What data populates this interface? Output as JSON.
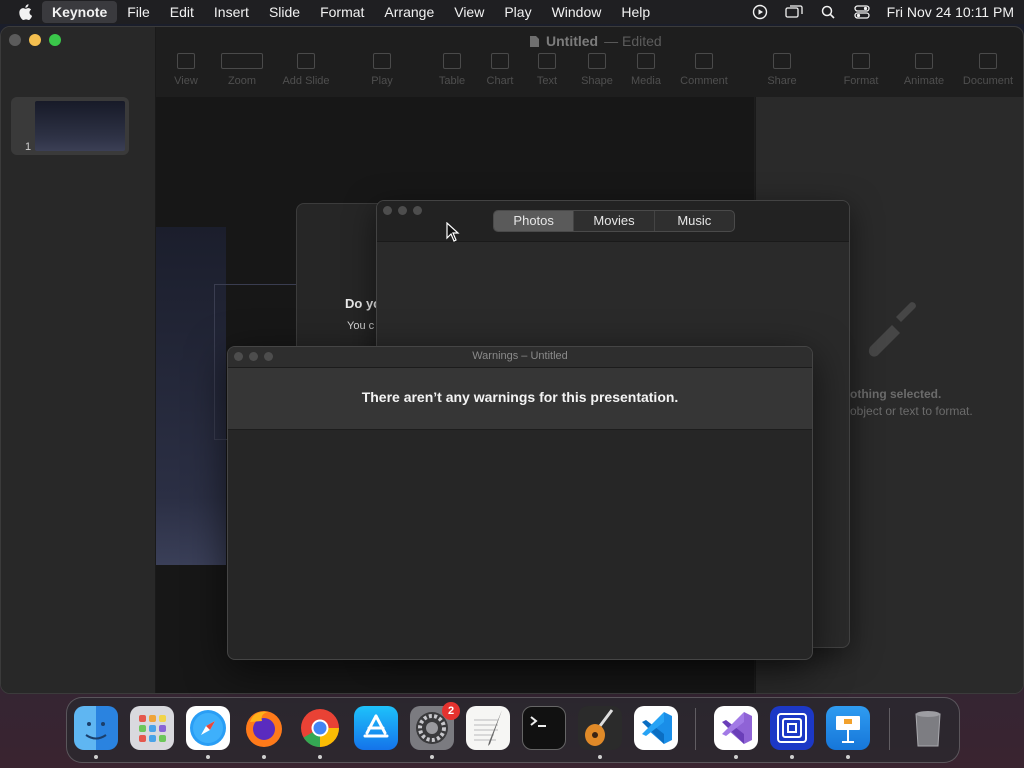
{
  "menubar": {
    "app_name": "Keynote",
    "items": [
      "File",
      "Edit",
      "Insert",
      "Slide",
      "Format",
      "Arrange",
      "View",
      "Play",
      "Window",
      "Help"
    ],
    "clock": "Fri Nov 24  10:11 PM"
  },
  "keynote": {
    "doc_title": "Untitled",
    "doc_state": "— Edited",
    "toolbar": [
      "View",
      "Zoom",
      "Add Slide",
      "Play",
      "Table",
      "Chart",
      "Text",
      "Shape",
      "Media",
      "Comment",
      "Share",
      "Format",
      "Animate",
      "Document"
    ],
    "slide_number": "1",
    "inspector": {
      "line1": "othing selected.",
      "line2": "object or text to format."
    }
  },
  "behind_dialog": {
    "question": "Do yo",
    "subtext": "You c"
  },
  "media_browser": {
    "tabs": [
      "Photos",
      "Movies",
      "Music"
    ],
    "active_tab": "Photos"
  },
  "warnings_window": {
    "title": "Warnings – Untitled",
    "message": "There aren’t any warnings for this presentation."
  },
  "dock": {
    "apps": [
      "Finder",
      "Launchpad",
      "Safari",
      "Firefox",
      "Chrome",
      "App Store",
      "System Settings",
      "TextEdit",
      "Terminal",
      "GarageBand",
      "Visual Studio Code",
      "Visual Studio",
      "Simulator",
      "Keynote",
      "Trash"
    ],
    "settings_badge": "2"
  },
  "colors": {
    "traffic_close": "#5b5b5b",
    "traffic_min": "#f4bf4f",
    "traffic_max": "#3ac74a",
    "badge": "#e5322f"
  }
}
